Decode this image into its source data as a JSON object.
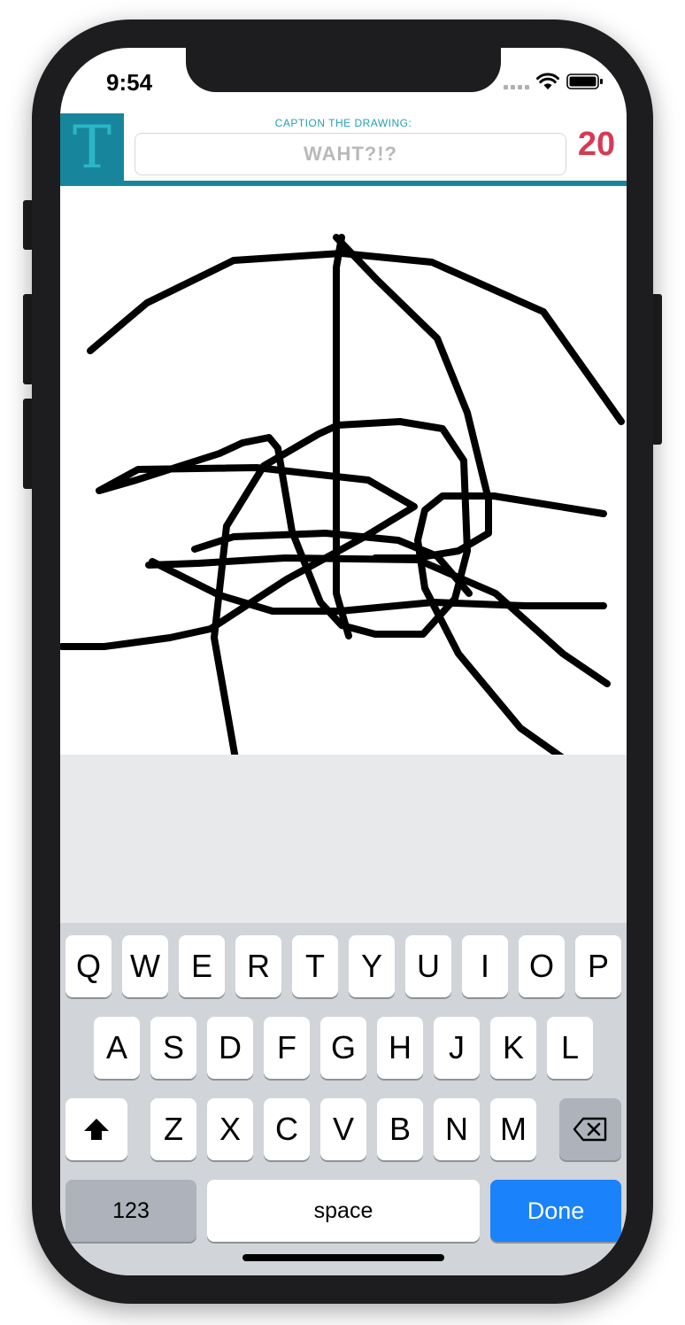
{
  "status_bar": {
    "time": "9:54",
    "icons": [
      "cellular-signal-icon",
      "wifi-icon",
      "battery-icon"
    ]
  },
  "header": {
    "logo_letter": "T",
    "caption_label": "CAPTION THE DRAWING:",
    "caption_value": "WAHT?!?",
    "timer": "20",
    "colors": {
      "accent": "#17869c",
      "timer": "#d63b55",
      "caption_label": "#26a0b3"
    }
  },
  "keyboard": {
    "row1": [
      "Q",
      "W",
      "E",
      "R",
      "T",
      "Y",
      "U",
      "I",
      "O",
      "P"
    ],
    "row2": [
      "A",
      "S",
      "D",
      "F",
      "G",
      "H",
      "J",
      "K",
      "L"
    ],
    "row3": [
      "Z",
      "X",
      "C",
      "V",
      "B",
      "N",
      "M"
    ],
    "shift_icon": "shift-icon",
    "backspace_icon": "backspace-icon",
    "numbers_label": "123",
    "space_label": "space",
    "done_label": "Done",
    "colors": {
      "done": "#1a82fb"
    }
  }
}
